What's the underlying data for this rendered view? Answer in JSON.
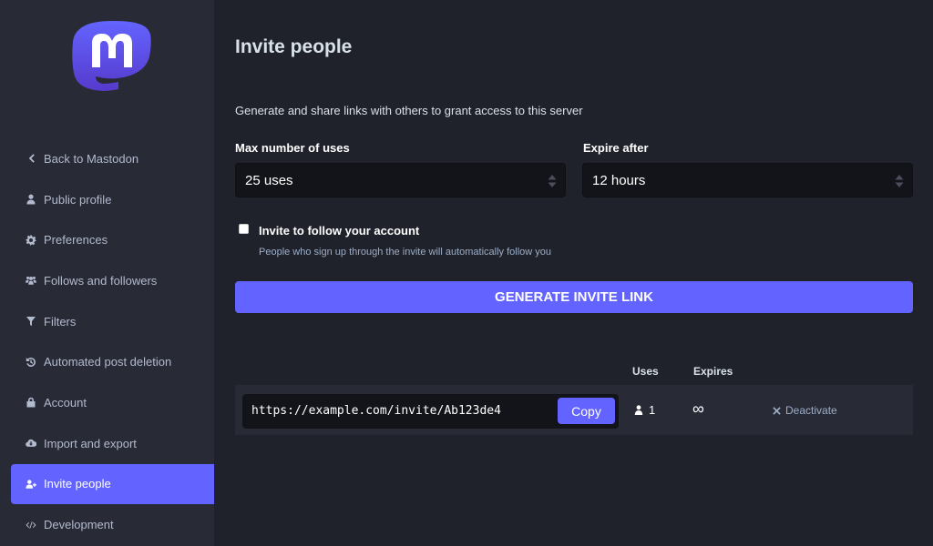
{
  "brand": {
    "accent": "#6364ff",
    "logo": "mastodon-logo"
  },
  "sidebar": {
    "items": [
      {
        "label": "Back to Mastodon",
        "icon": "chevron-left-icon",
        "active": false
      },
      {
        "label": "Public profile",
        "icon": "user-icon",
        "active": false
      },
      {
        "label": "Preferences",
        "icon": "gear-icon",
        "active": false
      },
      {
        "label": "Follows and followers",
        "icon": "users-icon",
        "active": false
      },
      {
        "label": "Filters",
        "icon": "filter-icon",
        "active": false
      },
      {
        "label": "Automated post deletion",
        "icon": "history-icon",
        "active": false
      },
      {
        "label": "Account",
        "icon": "lock-icon",
        "active": false
      },
      {
        "label": "Import and export",
        "icon": "cloud-download-icon",
        "active": false
      },
      {
        "label": "Invite people",
        "icon": "user-plus-icon",
        "active": true
      },
      {
        "label": "Development",
        "icon": "code-icon",
        "active": false
      }
    ]
  },
  "main": {
    "title": "Invite people",
    "lead": "Generate and share links with others to grant access to this server",
    "max_uses": {
      "label": "Max number of uses",
      "value": "25 uses"
    },
    "expire_after": {
      "label": "Expire after",
      "value": "12 hours"
    },
    "autofollow": {
      "label": "Invite to follow your account",
      "hint": "People who sign up through the invite will automatically follow you",
      "checked": false
    },
    "generate_label": "GENERATE INVITE LINK",
    "table": {
      "headers": {
        "uses": "Uses",
        "expires": "Expires"
      },
      "rows": [
        {
          "link": "https://example.com/invite/Ab123de4",
          "copy_label": "Copy",
          "uses": "1",
          "expires": "∞",
          "deactivate_label": "Deactivate"
        }
      ]
    }
  }
}
